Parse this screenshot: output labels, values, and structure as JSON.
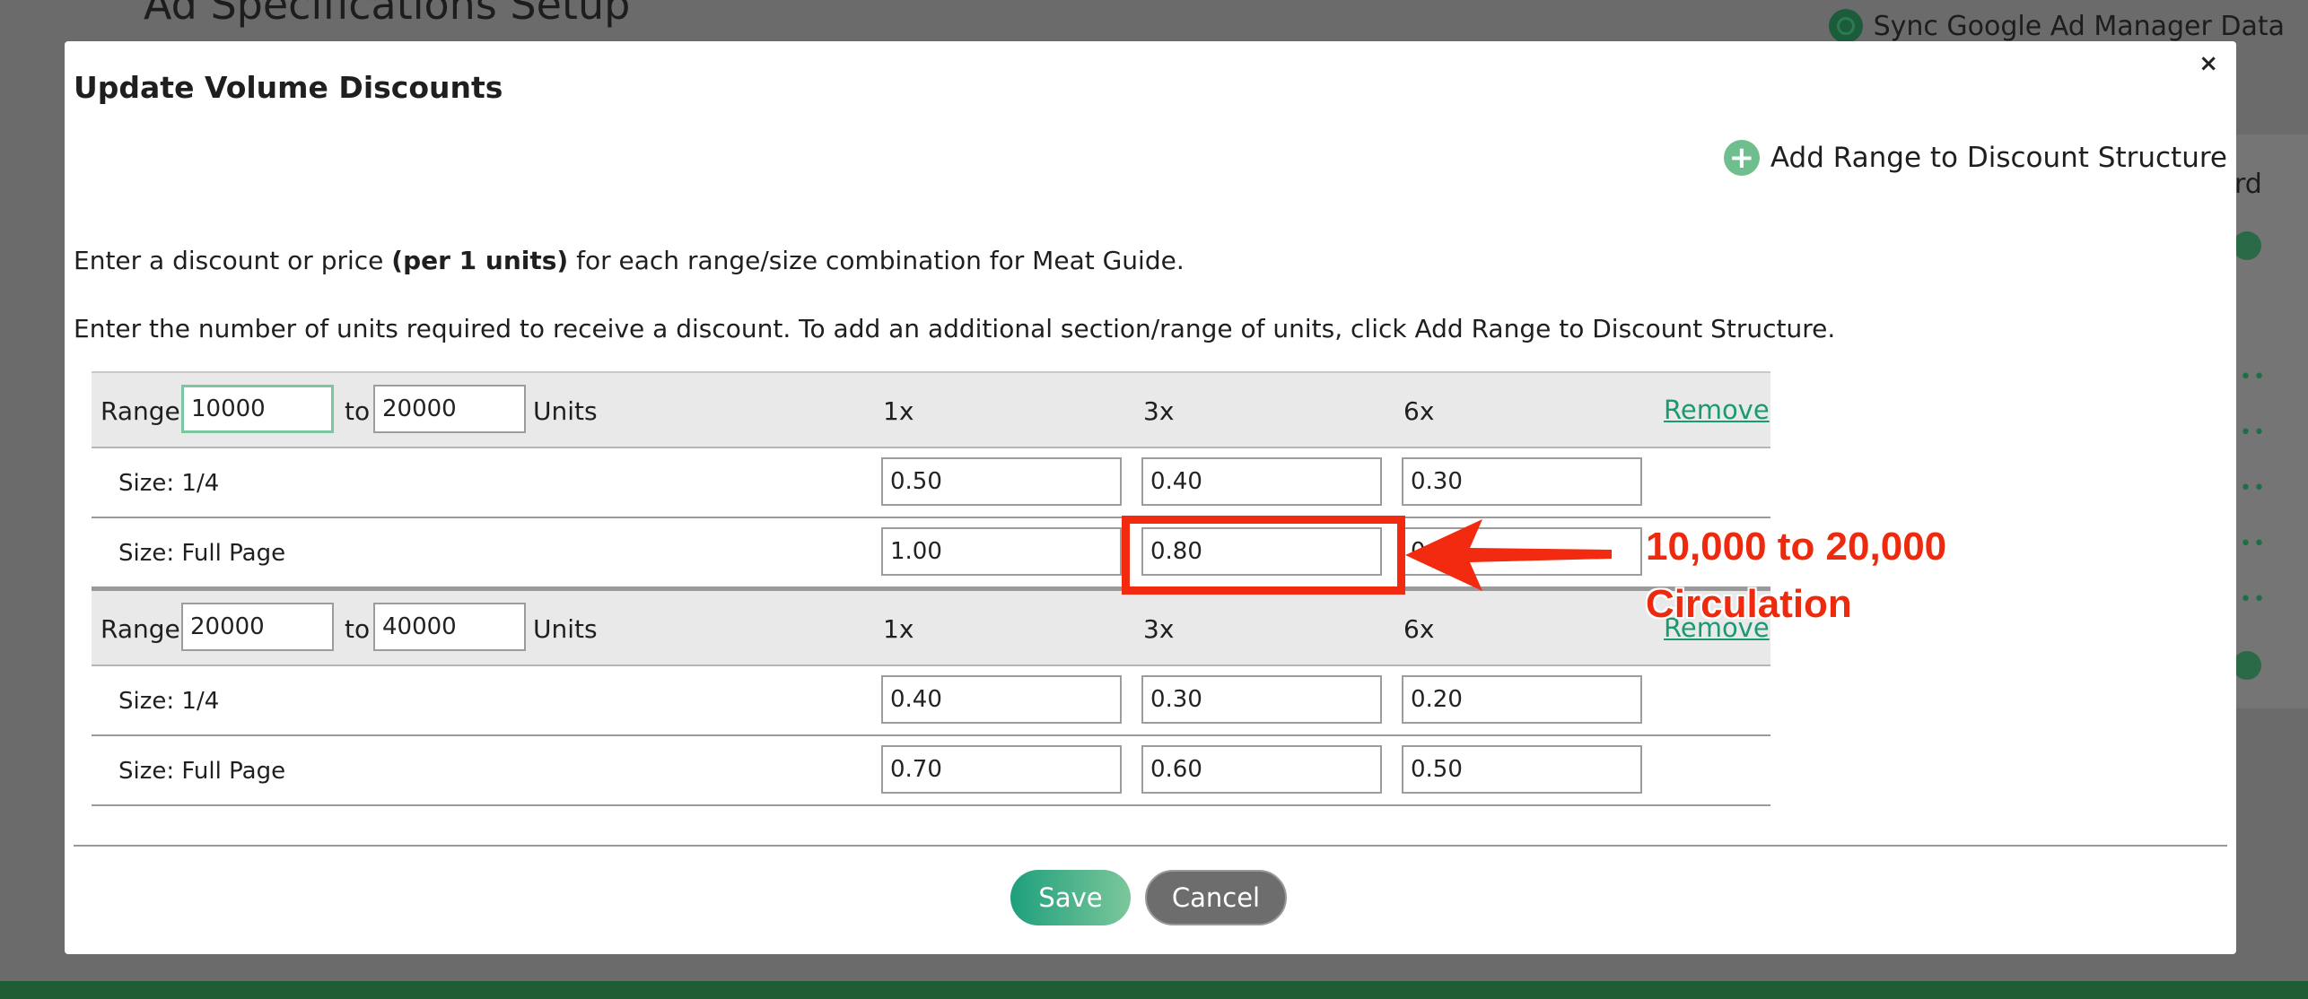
{
  "background": {
    "page_title": "Ad Specifications Setup",
    "sync_label": "Sync Google Ad Manager Data",
    "side_text": "rd"
  },
  "modal": {
    "title": "Update Volume Discounts",
    "close_symbol": "×",
    "add_range_label": "Add Range to Discount Structure",
    "instruction1_pre": "Enter a discount or price ",
    "instruction1_bold": "(per 1 units)",
    "instruction1_post": " for each range/size combination for Meat Guide.",
    "instruction2": "Enter the number of units required to receive a discount. To add an additional section/range of units, click Add Range to Discount Structure.",
    "range_label": "Range:",
    "to_label": "to",
    "units_label": "Units",
    "frequency_headers": [
      "1x",
      "3x",
      "6x"
    ],
    "remove_label": "Remove",
    "ranges": [
      {
        "from": "10000",
        "to": "20000",
        "sizes": [
          {
            "label": "Size: 1/4",
            "prices": [
              "0.50",
              "0.40",
              "0.30"
            ]
          },
          {
            "label": "Size: Full Page",
            "prices": [
              "1.00",
              "0.80",
              "0"
            ]
          }
        ]
      },
      {
        "from": "20000",
        "to": "40000",
        "sizes": [
          {
            "label": "Size: 1/4",
            "prices": [
              "0.40",
              "0.30",
              "0.20"
            ]
          },
          {
            "label": "Size: Full Page",
            "prices": [
              "0.70",
              "0.60",
              "0.50"
            ]
          }
        ]
      }
    ],
    "save_label": "Save",
    "cancel_label": "Cancel"
  },
  "annotation": {
    "line1": "10,000 to 20,000",
    "line2": "Circulation",
    "color": "#f22a10"
  },
  "colors": {
    "accent": "#1a9a70",
    "overlay": "#6b6b6b"
  }
}
